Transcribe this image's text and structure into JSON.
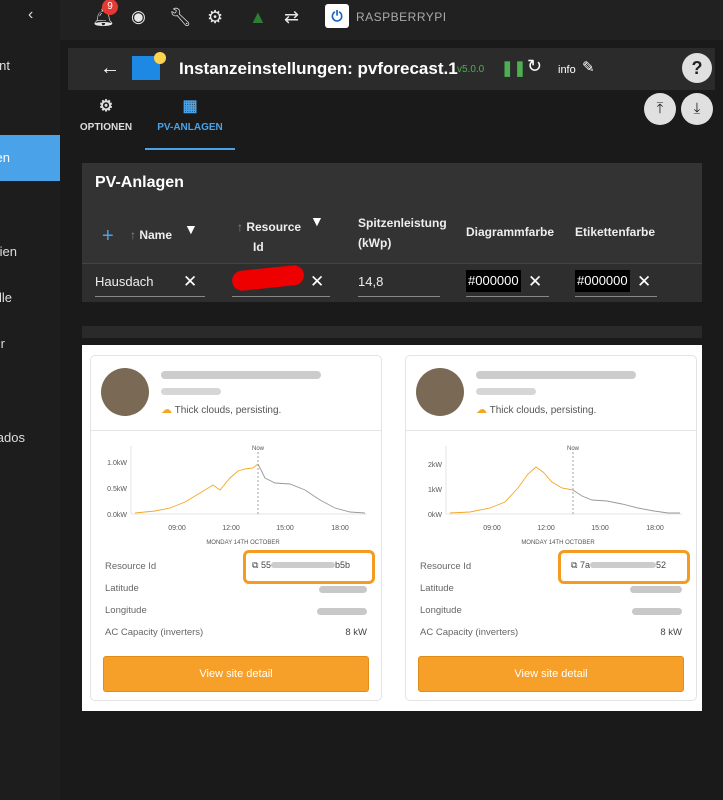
{
  "sidebar": {
    "items": [
      {
        "label": "nt"
      },
      {
        "label": "en"
      },
      {
        "label": "ien"
      },
      {
        "label": "lle"
      },
      {
        "label": "r"
      },
      {
        "label": "ados"
      }
    ]
  },
  "topbar": {
    "notification_count": "9",
    "host": "RASPBERRYPI"
  },
  "header": {
    "title": "Instanzeinstellungen: pvforecast.1",
    "version": "v5.0.0",
    "info_label": "info"
  },
  "tabs": [
    {
      "label": "OPTIONEN"
    },
    {
      "label": "PV-ANLAGEN"
    }
  ],
  "table": {
    "title": "PV-Anlagen",
    "columns": {
      "name": "Name",
      "resource_id_1": "Resource",
      "resource_id_2": "Id",
      "peak_1": "Spitzenleistung",
      "peak_2": "(kWp)",
      "chart_color": "Diagrammfarbe",
      "label_color": "Etikettenfarbe"
    },
    "row": {
      "name": "Hausdach",
      "peak": "14,8",
      "chart_color": "#000000",
      "label_color": "#000000"
    }
  },
  "sites": [
    {
      "weather": "Thick clouds, persisting.",
      "chart_labels": {
        "now": "Now",
        "date": "MONDAY 14TH OCTOBER"
      },
      "y_ticks": [
        "1.0kW",
        "0.5kW",
        "0.0kW"
      ],
      "x_ticks": [
        "09:00",
        "12:00",
        "15:00",
        "18:00"
      ],
      "resource_label": "Resource Id",
      "resource_prefix": "55",
      "resource_suffix": "b5b",
      "latitude_label": "Latitude",
      "longitude_label": "Longitude",
      "capacity_label": "AC Capacity (inverters)",
      "capacity_value": "8 kW",
      "button": "View site detail"
    },
    {
      "weather": "Thick clouds, persisting.",
      "chart_labels": {
        "now": "Now",
        "date": "MONDAY 14TH OCTOBER"
      },
      "y_ticks": [
        "2kW",
        "1kW",
        "0kW"
      ],
      "x_ticks": [
        "09:00",
        "12:00",
        "15:00",
        "18:00"
      ],
      "resource_label": "Resource Id",
      "resource_prefix": "7a",
      "resource_suffix": "52",
      "latitude_label": "Latitude",
      "longitude_label": "Longitude",
      "capacity_label": "AC Capacity (inverters)",
      "capacity_value": "8 kW",
      "button": "View site detail"
    }
  ],
  "colors": {
    "accent": "#4aa3e8",
    "orange": "#f6a02a",
    "green": "#4caf50"
  }
}
